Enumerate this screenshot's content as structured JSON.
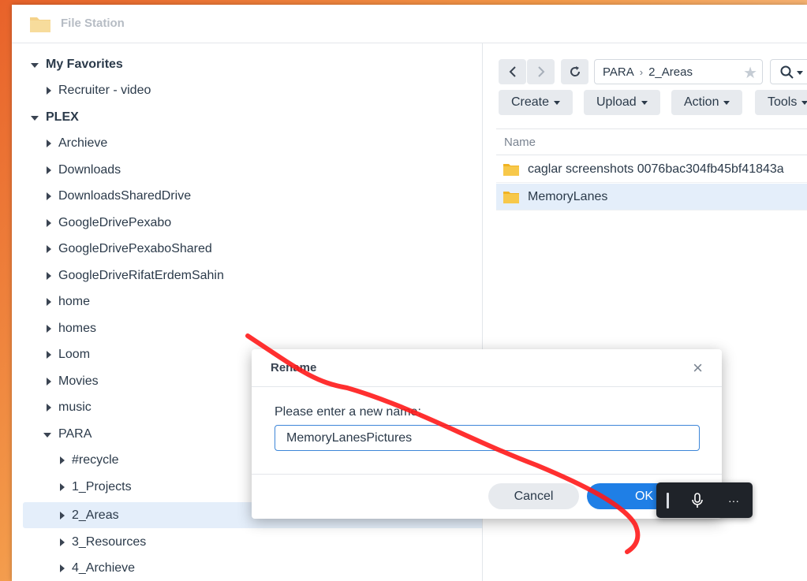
{
  "app": {
    "title": "File Station"
  },
  "sidebar": {
    "groups": [
      {
        "label": "My Favorites",
        "items": [
          "Recruiter - video"
        ]
      },
      {
        "label": "PLEX",
        "items": [
          "Archieve",
          "Downloads",
          "DownloadsSharedDrive",
          "GoogleDrivePexabo",
          "GoogleDrivePexaboShared",
          "GoogleDriveRifatErdemSahin",
          "home",
          "homes",
          "Loom",
          "Movies",
          "music",
          "PARA"
        ]
      }
    ],
    "para_children": [
      "#recycle",
      "1_Projects",
      "2_Areas",
      "3_Resources",
      "4_Archieve"
    ],
    "selected": "2_Areas"
  },
  "nav": {
    "path": [
      "PARA",
      "2_Areas"
    ],
    "path_separator": "›"
  },
  "toolbar": {
    "create": "Create",
    "upload": "Upload",
    "action": "Action",
    "tools": "Tools"
  },
  "list": {
    "header_name": "Name",
    "rows": [
      {
        "name": "caglar screenshots 0076bac304fb45bf41843a"
      },
      {
        "name": "MemoryLanes"
      }
    ]
  },
  "dialog": {
    "title": "Rename",
    "close": "×",
    "prompt": "Please enter a new name:",
    "value": "MemoryLanesPictures",
    "cancel": "Cancel",
    "ok": "OK"
  },
  "floatbar": {
    "more": "···"
  },
  "colors": {
    "accent": "#1f7fe6",
    "folder": "#f5c030",
    "annotation": "#ff1a1a"
  }
}
